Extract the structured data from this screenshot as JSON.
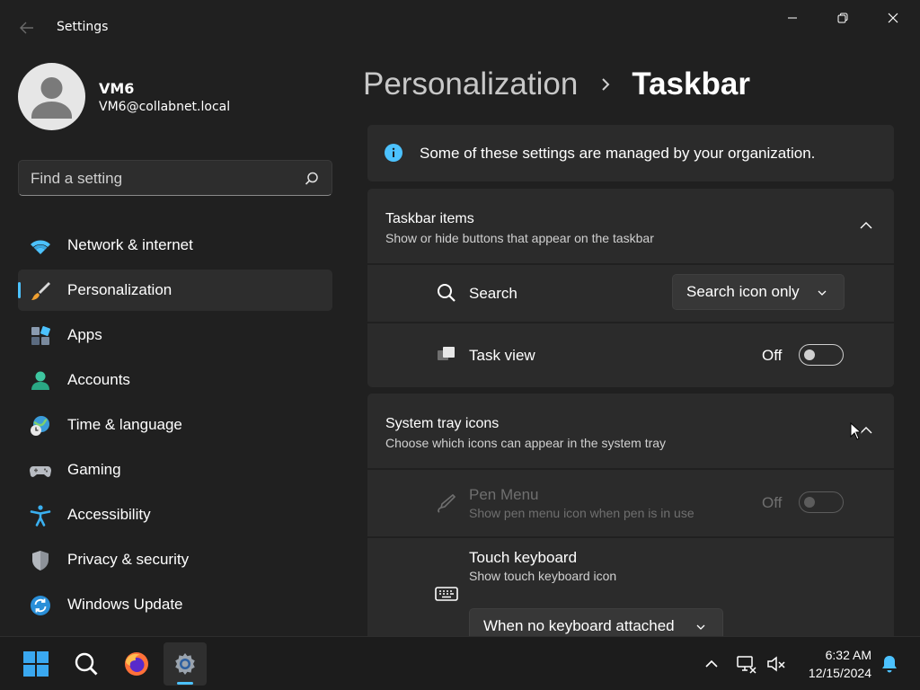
{
  "window": {
    "title": "Settings",
    "controls": [
      "minimize",
      "maximize",
      "close"
    ]
  },
  "profile": {
    "name": "VM6",
    "email": "VM6@collabnet.local"
  },
  "search": {
    "placeholder": "Find a setting"
  },
  "nav": {
    "items": [
      {
        "label": "Network & internet",
        "icon": "wifi-icon",
        "active": false
      },
      {
        "label": "Personalization",
        "icon": "brush-icon",
        "active": true
      },
      {
        "label": "Apps",
        "icon": "apps-icon",
        "active": false
      },
      {
        "label": "Accounts",
        "icon": "person-icon",
        "active": false
      },
      {
        "label": "Time & language",
        "icon": "globe-clock-icon",
        "active": false
      },
      {
        "label": "Gaming",
        "icon": "gamepad-icon",
        "active": false
      },
      {
        "label": "Accessibility",
        "icon": "accessibility-icon",
        "active": false
      },
      {
        "label": "Privacy & security",
        "icon": "shield-icon",
        "active": false
      },
      {
        "label": "Windows Update",
        "icon": "update-icon",
        "active": false
      }
    ]
  },
  "breadcrumb": {
    "parent": "Personalization",
    "current": "Taskbar"
  },
  "info_banner": {
    "text": "Some of these settings are managed by your organization."
  },
  "taskbar_items": {
    "title": "Taskbar items",
    "subtitle": "Show or hide buttons that appear on the taskbar",
    "search": {
      "label": "Search",
      "value": "Search icon only"
    },
    "task_view": {
      "label": "Task view",
      "state": "Off"
    }
  },
  "system_tray": {
    "title": "System tray icons",
    "subtitle": "Choose which icons can appear in the system tray",
    "pen_menu": {
      "label": "Pen Menu",
      "description": "Show pen menu icon when pen is in use",
      "state": "Off"
    },
    "touch_keyboard": {
      "label": "Touch keyboard",
      "description": "Show touch keyboard icon",
      "value": "When no keyboard attached"
    }
  },
  "taskbar": {
    "time": "6:32 AM",
    "date": "12/15/2024"
  },
  "colors": {
    "accent": "#4cc2ff",
    "background": "#202020",
    "card": "#2b2b2b"
  }
}
